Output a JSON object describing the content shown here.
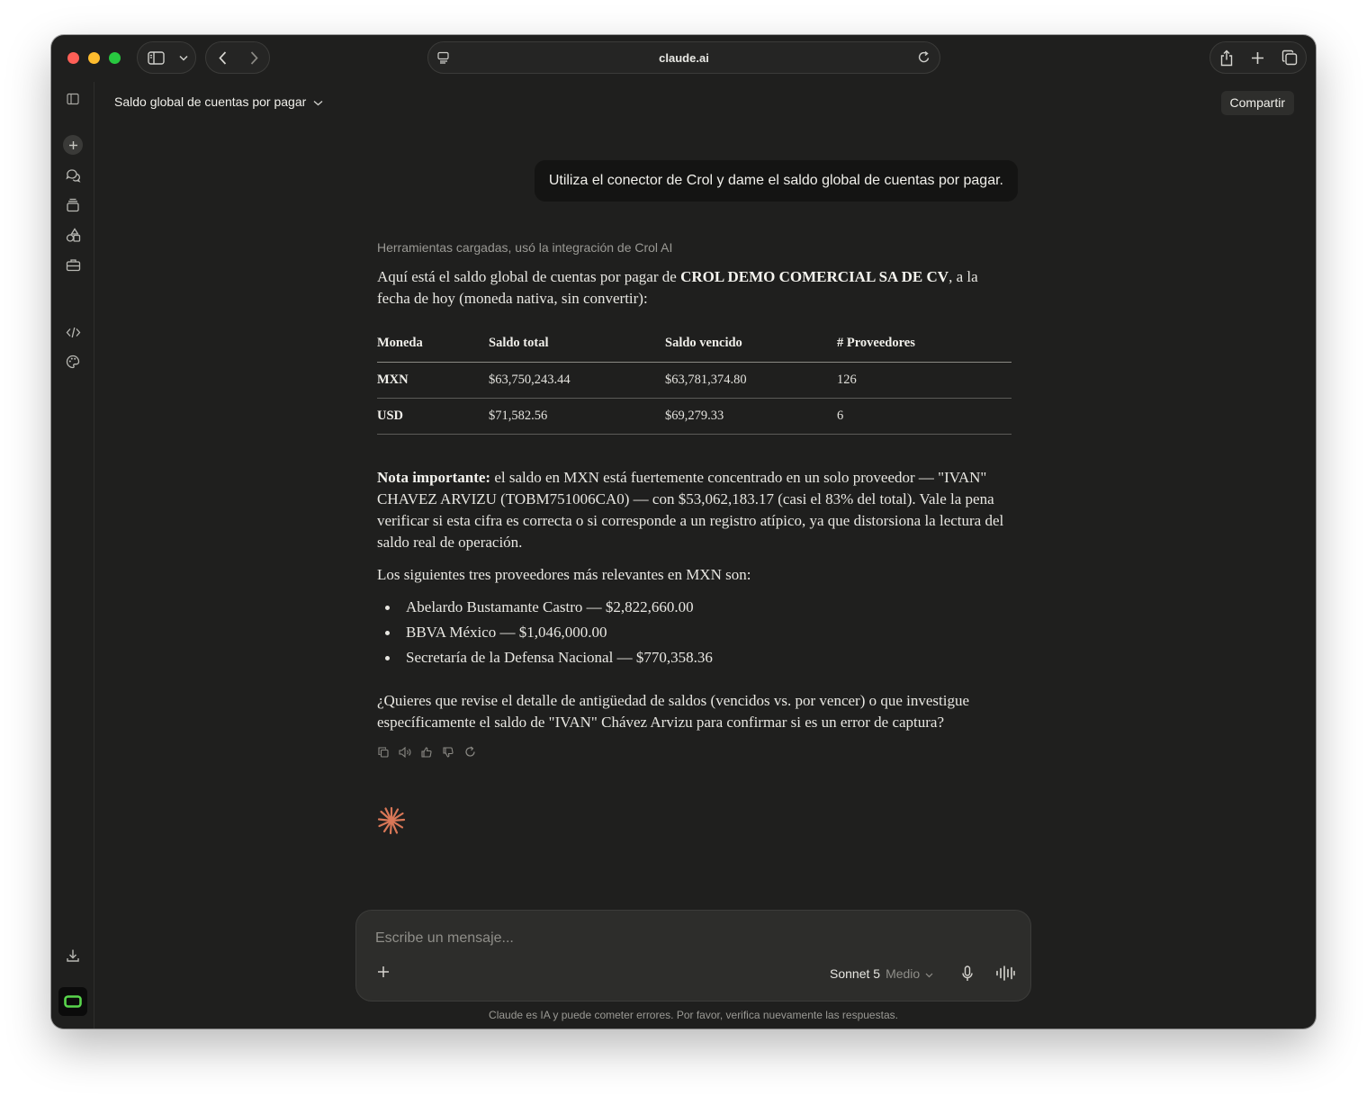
{
  "browser": {
    "url": "claude.ai"
  },
  "header": {
    "conversation_title": "Saldo global de cuentas por pagar",
    "share_label": "Compartir"
  },
  "user_message": "Utiliza el conector de Crol y dame el saldo global de cuentas por pagar.",
  "assistant": {
    "tools_line": "Herramientas cargadas, usó la integración de Crol AI",
    "intro_before": "Aquí está el saldo global de cuentas por pagar de ",
    "intro_company": "CROL DEMO COMERCIAL SA DE CV",
    "intro_after": ", a la fecha de hoy (moneda nativa, sin convertir):",
    "table": {
      "headers": [
        "Moneda",
        "Saldo total",
        "Saldo vencido",
        "# Proveedores"
      ],
      "rows": [
        [
          "MXN",
          "$63,750,243.44",
          "$63,781,374.80",
          "126"
        ],
        [
          "USD",
          "$71,582.56",
          "$69,279.33",
          "6"
        ]
      ]
    },
    "note_label": "Nota importante:",
    "note_text": " el saldo en MXN está fuertemente concentrado en un solo proveedor — \"IVAN\" CHAVEZ ARVIZU (TOBM751006CA0) — con $53,062,183.17 (casi el 83% del total). Vale la pena verificar si esta cifra es correcta o si corresponde a un registro atípico, ya que distorsiona la lectura del saldo real de operación.",
    "list_intro": "Los siguientes tres proveedores más relevantes en MXN son:",
    "providers": [
      "Abelardo Bustamante Castro — $2,822,660.00",
      "BBVA México — $1,046,000.00",
      "Secretaría de la Defensa Nacional — $770,358.36"
    ],
    "question": "¿Quieres que revise el detalle de antigüedad de saldos (vencidos vs. por vencer) o que investigue específicamente el saldo de \"IVAN\" Chávez Arvizu para confirmar si es un error de captura?"
  },
  "composer": {
    "placeholder": "Escribe un mensaje...",
    "model": "Sonnet 5",
    "mode": "Medio"
  },
  "disclaimer": "Claude es IA y puede cometer errores. Por favor, verifica nuevamente las respuestas.",
  "colors": {
    "background": "#1f1f1e",
    "user_bubble": "#141413",
    "accent_spark": "#d97757"
  }
}
